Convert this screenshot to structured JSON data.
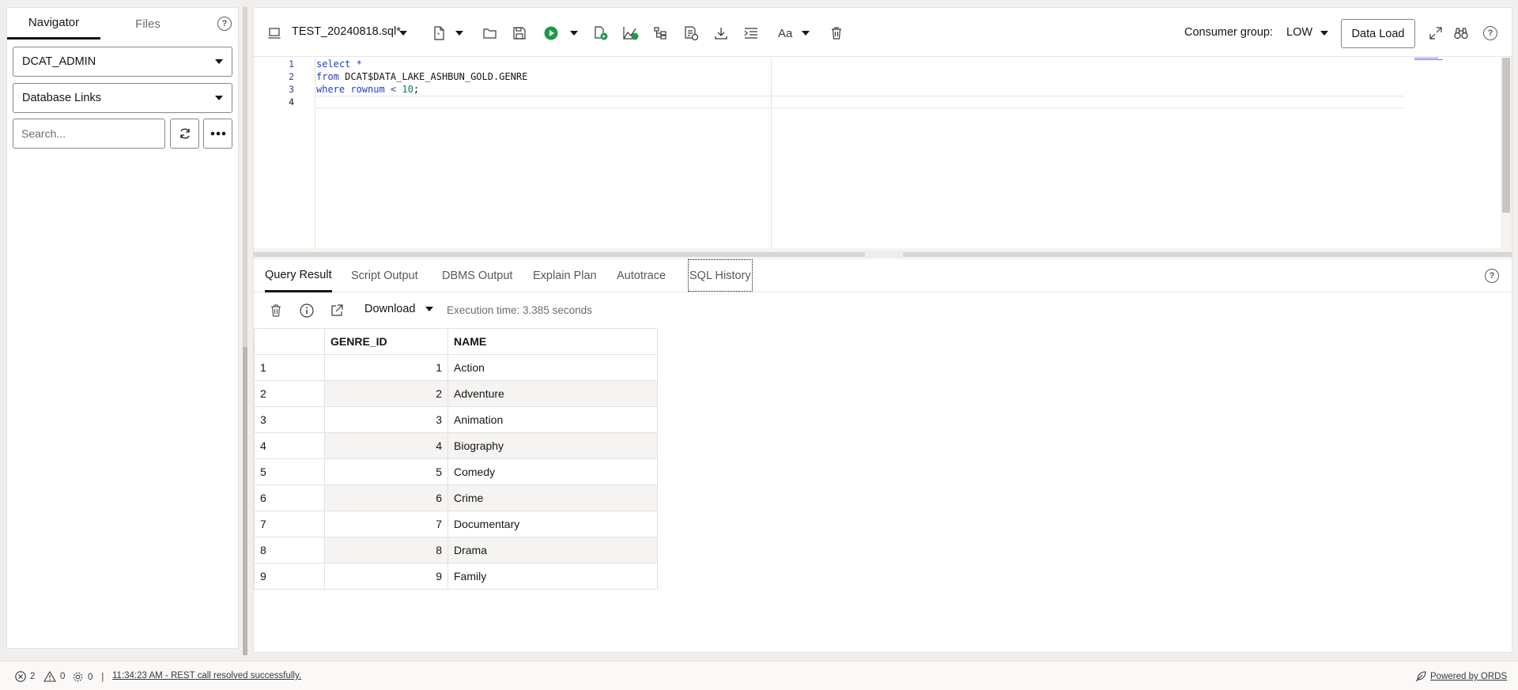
{
  "navigator": {
    "tabs": [
      "Navigator",
      "Files"
    ],
    "schema_select": "DCAT_ADMIN",
    "object_type_select": "Database Links",
    "search_placeholder": "Search..."
  },
  "editor": {
    "file_title": "TEST_20240818.sql*",
    "consumer_group_label": "Consumer group:",
    "consumer_group_value": "LOW",
    "data_load_label": "Data Load",
    "line_numbers": [
      "1",
      "2",
      "3",
      "4"
    ],
    "code": {
      "line1_kw": "select",
      "line1_rest": " *",
      "line2_kw": "from",
      "line2_rest": " DCAT$DATA_LAKE_ASHBUN_GOLD.GENRE",
      "line3_kw": "where",
      "line3_mid": " rownum < ",
      "line3_num": "10",
      "line3_end": ";"
    }
  },
  "results": {
    "tabs": [
      "Query Result",
      "Script Output",
      "DBMS Output",
      "Explain Plan",
      "Autotrace",
      "SQL History"
    ],
    "download_label": "Download",
    "execution_time": "Execution time: 3.385 seconds",
    "columns": [
      "GENRE_ID",
      "NAME"
    ],
    "rows": [
      {
        "n": "1",
        "id": "1",
        "name": "Action"
      },
      {
        "n": "2",
        "id": "2",
        "name": "Adventure"
      },
      {
        "n": "3",
        "id": "3",
        "name": "Animation"
      },
      {
        "n": "4",
        "id": "4",
        "name": "Biography"
      },
      {
        "n": "5",
        "id": "5",
        "name": "Comedy"
      },
      {
        "n": "6",
        "id": "6",
        "name": "Crime"
      },
      {
        "n": "7",
        "id": "7",
        "name": "Documentary"
      },
      {
        "n": "8",
        "id": "8",
        "name": "Drama"
      },
      {
        "n": "9",
        "id": "9",
        "name": "Family"
      }
    ]
  },
  "status_bar": {
    "errors": "2",
    "warnings": "0",
    "tasks": "0",
    "separator": "|",
    "message": "11:34:23 AM - REST call resolved successfully.",
    "powered_by": "Powered by ORDS"
  },
  "colors": {
    "run_green": "#1f9a4a",
    "accent_text": "#161513"
  }
}
